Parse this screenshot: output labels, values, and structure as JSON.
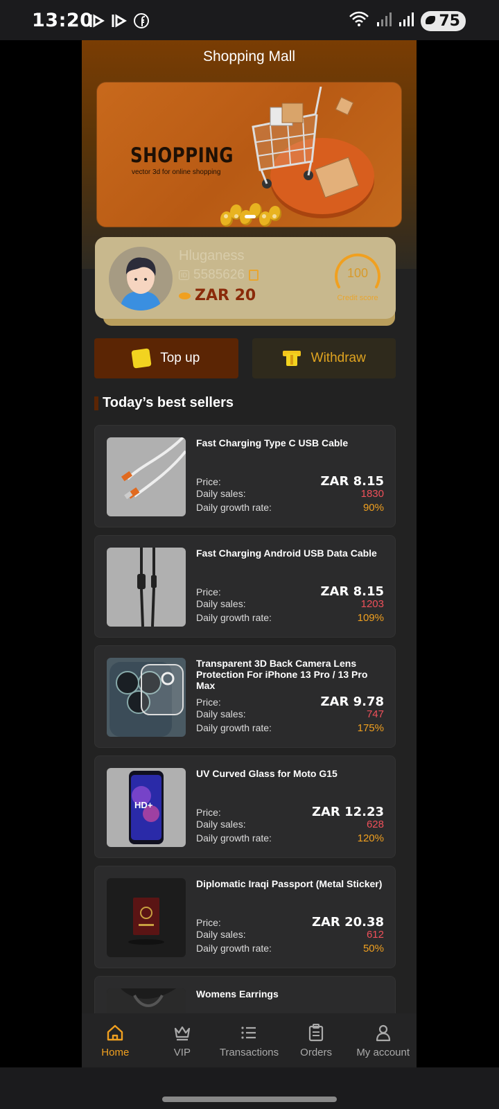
{
  "status": {
    "time": "13:20",
    "battery": "75"
  },
  "header": {
    "title": "Shopping Mall"
  },
  "banner": {
    "title": "SHOPPING",
    "subtitle": "vector 3d for online shopping",
    "dots": 5,
    "active_dot": 2
  },
  "profile": {
    "username": "Hluganess",
    "id_badge": "ID",
    "user_id": "5585626",
    "balance": "ZAR 20",
    "credit_score": "100",
    "credit_label": "Credit score"
  },
  "actions": {
    "topup": "Top up",
    "withdraw": "Withdraw"
  },
  "section": {
    "title": "Today’s best sellers"
  },
  "labels": {
    "price": "Price:",
    "daily_sales": "Daily sales:",
    "growth": "Daily growth rate:"
  },
  "products": [
    {
      "name": "Fast Charging Type C USB Cable",
      "price": "ZAR 8.15",
      "sales": "1830",
      "growth": "90%"
    },
    {
      "name": "Fast Charging Android USB Data Cable",
      "price": "ZAR 8.15",
      "sales": "1203",
      "growth": "109%"
    },
    {
      "name": "Transparent 3D Back Camera Lens Protection For iPhone 13 Pro / 13 Pro Max",
      "price": "ZAR 9.78",
      "sales": "747",
      "growth": "175%"
    },
    {
      "name": "UV Curved Glass for Moto G15",
      "price": "ZAR 12.23",
      "sales": "628",
      "growth": "120%"
    },
    {
      "name": "Diplomatic Iraqi Passport (Metal Sticker)",
      "price": "ZAR 20.38",
      "sales": "612",
      "growth": "50%"
    },
    {
      "name": "Womens Earrings"
    }
  ],
  "tabs": [
    {
      "label": "Home",
      "icon": "home-icon",
      "active": true
    },
    {
      "label": "VIP",
      "icon": "crown-icon"
    },
    {
      "label": "Transactions",
      "icon": "list-icon"
    },
    {
      "label": "Orders",
      "icon": "clipboard-icon"
    },
    {
      "label": "My account",
      "icon": "user-icon"
    }
  ],
  "colors": {
    "accent": "#f0a020",
    "sales": "#f0505a",
    "topup_bg": "#5b2504",
    "profile_bg": "#c8b88d"
  }
}
